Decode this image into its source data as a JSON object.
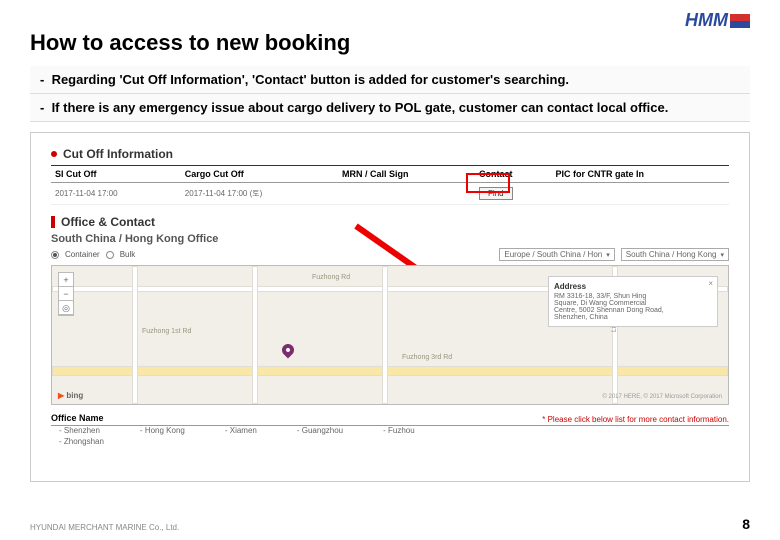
{
  "logo": "HMM",
  "title": "How to access to new booking",
  "bullets": [
    "Regarding 'Cut Off Information', 'Contact' button is added for customer's searching.",
    "If there is any emergency issue about cargo delivery to POL gate, customer can contact local office."
  ],
  "cutoff": {
    "heading": "Cut Off Information",
    "cols": [
      "SI Cut Off",
      "Cargo Cut Off",
      "MRN / Call Sign",
      "Contact",
      "PIC for CNTR gate In"
    ],
    "row": {
      "si": "2017-11-04 17:00",
      "cargo": "2017-11-04 17:00 (토)",
      "mrn": "",
      "contact": "Find",
      "pic": ""
    }
  },
  "office": {
    "heading": "Office & Contact",
    "sub": "South China / Hong Kong Office",
    "radio": {
      "container": "Container",
      "bulk": "Bulk"
    },
    "selects": {
      "loc": "Europe / South China / Hon",
      "office": "South China / Hong Kong"
    },
    "addr": {
      "title": "Address",
      "lines": [
        "RM 3316-18, 33/F, Shun Hing",
        "Square, Di Wang Commercial",
        "Centre, 5002 Shennan Dong Road,",
        "Shenzhen, China"
      ]
    },
    "roads": {
      "f1": "Fuzhong Rd",
      "f2": "Fuzhong 1st Rd",
      "f3": "Fuzhong 3rd Rd",
      "lixin": "Lixin Rd"
    },
    "bing": "bing",
    "copy": "© 2017 HERE, © 2017 Microsoft Corporation",
    "list_hdr": "Office Name",
    "list_note": "* Please click below list for more contact information.",
    "offices": [
      [
        "Shenzhen",
        "Hong Kong",
        "Xiamen",
        "Guangzhou",
        "Fuzhou"
      ],
      [
        "Zhongshan"
      ]
    ]
  },
  "footer": {
    "left": "HYUNDAI MERCHANT MARINE Co., Ltd.",
    "page": "8"
  }
}
